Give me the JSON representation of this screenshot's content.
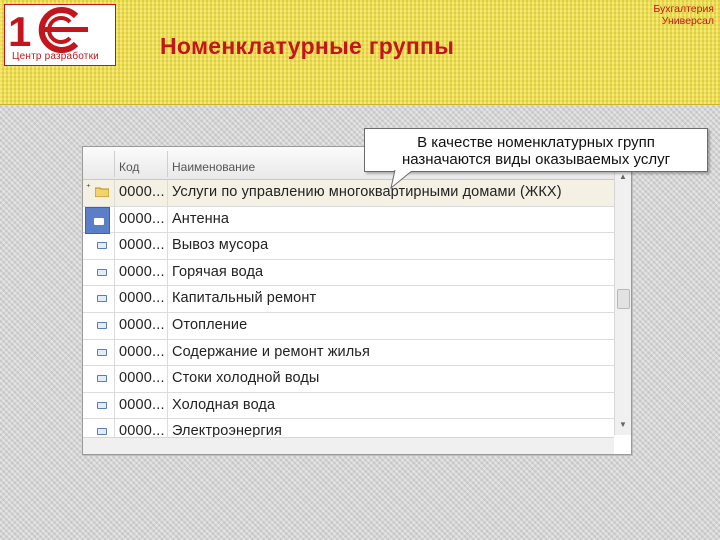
{
  "header": {
    "title": "Номенклатурные группы",
    "logo_caption": "Центр разработки",
    "corner_line1": "Бухгалтерия",
    "corner_line2": "Универсал"
  },
  "callout": {
    "line1": "В качестве номенклатурных групп",
    "line2": "назначаются виды оказываемых услуг"
  },
  "table": {
    "columns": [
      "Код",
      "Наименование"
    ],
    "rows": [
      {
        "code": "0000...",
        "name": "Услуги по управлению многоквартирными домами (ЖКХ)",
        "type": "folder"
      },
      {
        "code": "0000...",
        "name": "Антенна",
        "type": "item"
      },
      {
        "code": "0000...",
        "name": "Вывоз мусора",
        "type": "item"
      },
      {
        "code": "0000...",
        "name": "Горячая вода",
        "type": "item"
      },
      {
        "code": "0000...",
        "name": "Капитальный ремонт",
        "type": "item"
      },
      {
        "code": "0000...",
        "name": "Отопление",
        "type": "item"
      },
      {
        "code": "0000...",
        "name": "Содержание и ремонт жилья",
        "type": "item"
      },
      {
        "code": "0000...",
        "name": "Стоки холодной воды",
        "type": "item"
      },
      {
        "code": "0000...",
        "name": "Холодная вода",
        "type": "item"
      },
      {
        "code": "0000...",
        "name": "Электроэнергия",
        "type": "item"
      }
    ]
  },
  "colors": {
    "brand_red": "#c2161c",
    "header_yellow": "#f2e043",
    "selection_blue": "#5b7ec9"
  }
}
